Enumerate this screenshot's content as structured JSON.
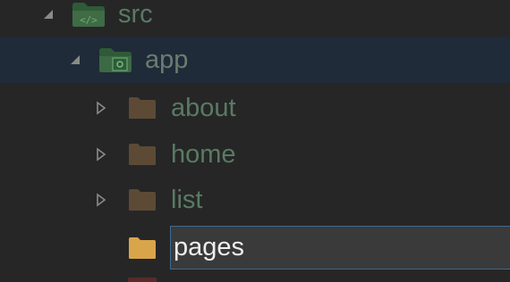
{
  "tree": {
    "items": [
      {
        "label": "src",
        "expanded": true,
        "icon": "folder-src-icon",
        "selected": false
      },
      {
        "label": "app",
        "expanded": true,
        "icon": "folder-app-icon",
        "selected": true
      },
      {
        "label": "about",
        "expanded": false,
        "icon": "folder-icon",
        "selected": false
      },
      {
        "label": "home",
        "expanded": false,
        "icon": "folder-icon",
        "selected": false
      },
      {
        "label": "list",
        "expanded": false,
        "icon": "folder-icon",
        "selected": false
      }
    ],
    "new_folder": {
      "value": "pages",
      "icon": "folder-icon"
    }
  },
  "colors": {
    "background": "#262627",
    "selected_row": "#1f2b38",
    "folder_dim": "#5c4a35",
    "folder_active": "#d9a54a",
    "src_folder_green": "#3f6b45",
    "label_green": "#5a7a63",
    "input_border": "#3f6a8f"
  }
}
